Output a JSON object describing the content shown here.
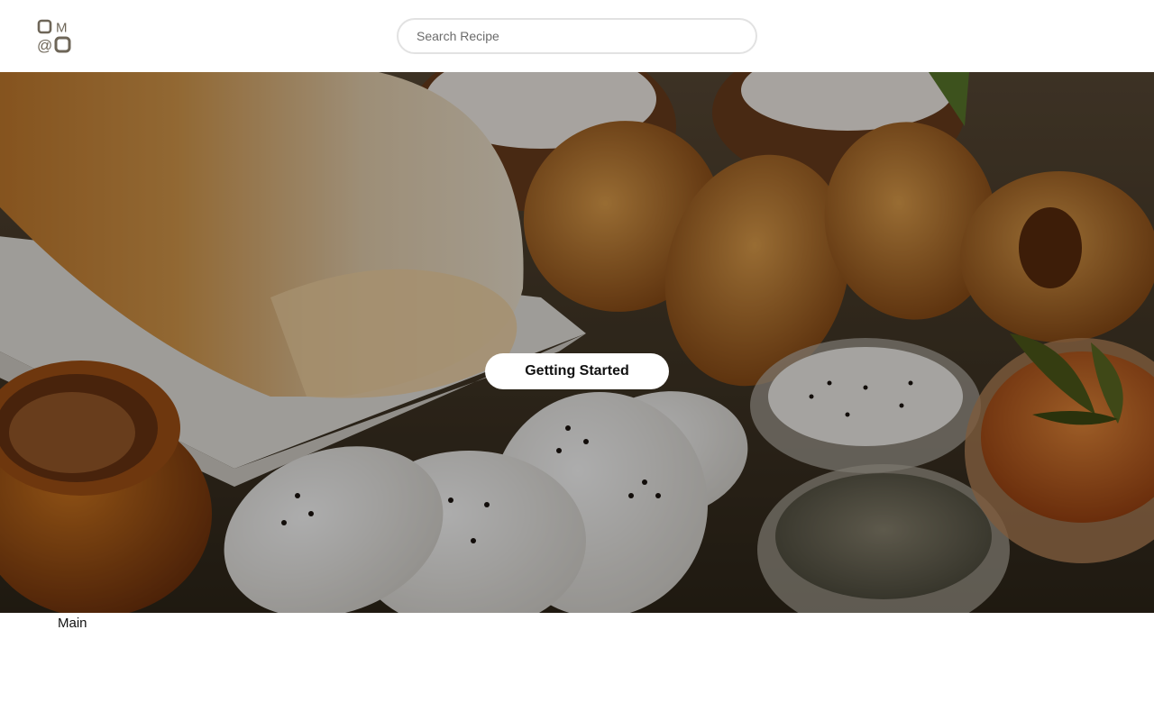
{
  "header": {
    "logo": {
      "letters": [
        "O",
        "M",
        "@",
        "O"
      ]
    },
    "search": {
      "placeholder": "Search Recipe",
      "value": ""
    }
  },
  "hero": {
    "image": "south indian breakfast spread: dosa, medu vada, idli, coconut chutney, mint chutney, sambar, pickle",
    "cta_label": "Getting Started"
  },
  "main": {
    "label": "Main"
  },
  "colors": {
    "logo": "#6e6658",
    "cta_bg": "#ffffff",
    "search_border": "#e2e2e2"
  }
}
